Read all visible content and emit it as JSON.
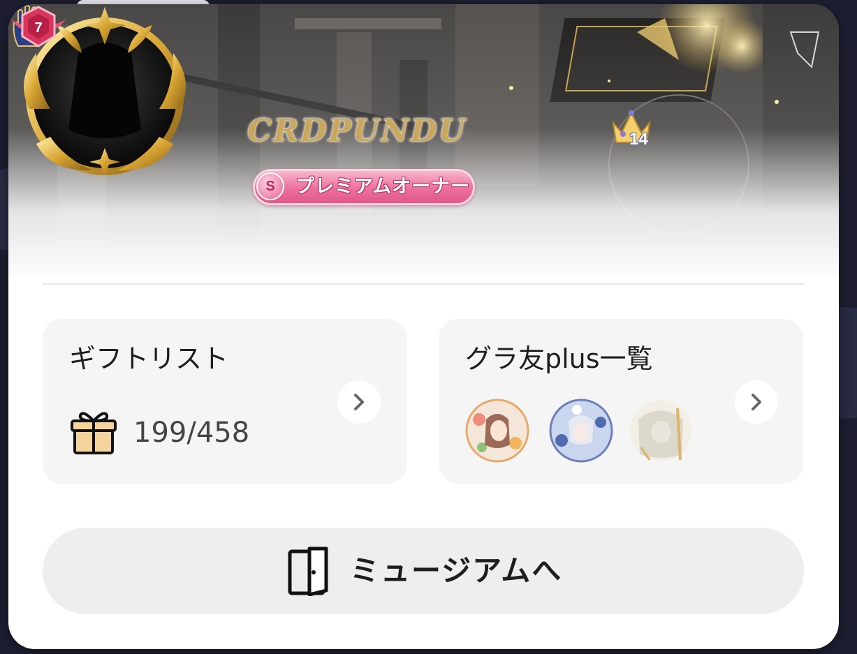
{
  "profile": {
    "username": "CRDPUNDU",
    "badge_label": "プレミアムオーナー",
    "badge_medal_letter": "S",
    "rank_level": "7",
    "crown_count": "14",
    "icons": [
      "hamsa-eye-icon",
      "winged-rank-icon",
      "crown-icon"
    ]
  },
  "gift_card": {
    "title": "ギフトリスト",
    "count": "199/458",
    "icon": "gift-icon"
  },
  "friends_card": {
    "title": "グラ友plus一覧",
    "avatars": [
      "friend-avatar-1",
      "friend-avatar-2",
      "friend-avatar-3"
    ]
  },
  "museum_button": {
    "label": "ミュージアムへ",
    "icon": "door-icon"
  },
  "colors": {
    "badge_pink": "#e1588a",
    "card_bg": "#f5f5f5",
    "button_bg": "#eeeeee",
    "gold": "#c9a85e"
  }
}
